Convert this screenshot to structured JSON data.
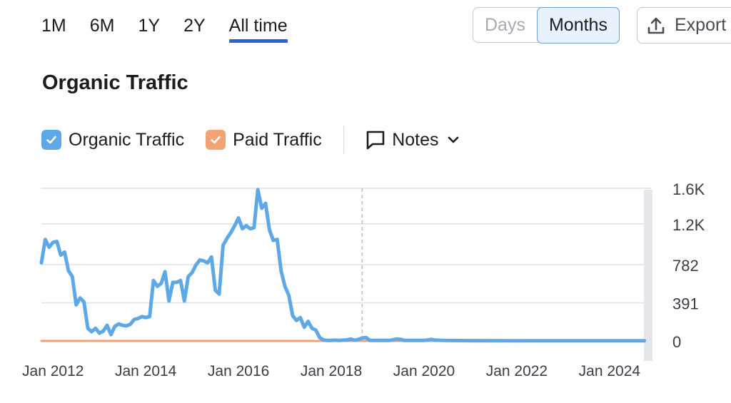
{
  "period_tabs": [
    {
      "label": "1M",
      "active": false
    },
    {
      "label": "6M",
      "active": false
    },
    {
      "label": "1Y",
      "active": false
    },
    {
      "label": "2Y",
      "active": false
    },
    {
      "label": "All time",
      "active": true
    }
  ],
  "granularity": {
    "days_label": "Days",
    "months_label": "Months",
    "selected": "Months"
  },
  "export_label": "Export",
  "icons": {
    "export": "upload-icon",
    "notes": "speech-bubble-icon",
    "dropdown": "chevron-down-icon",
    "check": "checkmark-icon"
  },
  "legend": {
    "organic": {
      "label": "Organic Traffic",
      "checked": true,
      "color": "#5fa8e8"
    },
    "paid": {
      "label": "Paid Traffic",
      "checked": true,
      "color": "#f2a273"
    },
    "notes_label": "Notes"
  },
  "colors": {
    "accent": "#2b64d1",
    "organic": "#5fa8e8",
    "paid": "#f2a273",
    "grid": "#dfe1e6"
  },
  "chart_data": {
    "type": "line",
    "title": "Organic Traffic",
    "x_unit": "month",
    "xlim": [
      "2011-10",
      "2024-11"
    ],
    "ylim": [
      0,
      1564
    ],
    "y_ticks": [
      0,
      391,
      782,
      1200,
      1564
    ],
    "y_tick_labels": [
      "0",
      "391",
      "782",
      "1.2K",
      "1.6K"
    ],
    "x_ticks": [
      "2012-01",
      "2014-01",
      "2016-01",
      "2018-01",
      "2020-01",
      "2022-01",
      "2024-01"
    ],
    "x_tick_labels": [
      "Jan 2012",
      "Jan 2014",
      "Jan 2016",
      "Jan 2018",
      "Jan 2020",
      "Jan 2022",
      "Jan 2024"
    ],
    "annotation_line_x": "2018-09",
    "grid": true,
    "legend_position": "top-left",
    "series": [
      {
        "name": "Organic Traffic",
        "color": "#5fa8e8",
        "points": [
          [
            "2011-10",
            800
          ],
          [
            "2011-11",
            1040
          ],
          [
            "2011-12",
            960
          ],
          [
            "2012-01",
            1010
          ],
          [
            "2012-02",
            1020
          ],
          [
            "2012-03",
            880
          ],
          [
            "2012-04",
            910
          ],
          [
            "2012-05",
            720
          ],
          [
            "2012-06",
            660
          ],
          [
            "2012-07",
            370
          ],
          [
            "2012-08",
            440
          ],
          [
            "2012-09",
            400
          ],
          [
            "2012-10",
            130
          ],
          [
            "2012-11",
            95
          ],
          [
            "2012-12",
            130
          ],
          [
            "2013-01",
            80
          ],
          [
            "2013-02",
            100
          ],
          [
            "2013-03",
            160
          ],
          [
            "2013-04",
            65
          ],
          [
            "2013-05",
            150
          ],
          [
            "2013-06",
            175
          ],
          [
            "2013-07",
            160
          ],
          [
            "2013-08",
            155
          ],
          [
            "2013-09",
            170
          ],
          [
            "2013-10",
            220
          ],
          [
            "2013-11",
            230
          ],
          [
            "2013-12",
            250
          ],
          [
            "2014-01",
            240
          ],
          [
            "2014-02",
            250
          ],
          [
            "2014-03",
            620
          ],
          [
            "2014-04",
            560
          ],
          [
            "2014-05",
            590
          ],
          [
            "2014-06",
            710
          ],
          [
            "2014-07",
            410
          ],
          [
            "2014-08",
            600
          ],
          [
            "2014-09",
            600
          ],
          [
            "2014-10",
            620
          ],
          [
            "2014-11",
            410
          ],
          [
            "2014-12",
            660
          ],
          [
            "2015-01",
            700
          ],
          [
            "2015-02",
            780
          ],
          [
            "2015-03",
            830
          ],
          [
            "2015-04",
            820
          ],
          [
            "2015-05",
            800
          ],
          [
            "2015-06",
            860
          ],
          [
            "2015-07",
            520
          ],
          [
            "2015-08",
            480
          ],
          [
            "2015-09",
            980
          ],
          [
            "2015-10",
            1050
          ],
          [
            "2015-11",
            1110
          ],
          [
            "2015-12",
            1180
          ],
          [
            "2016-01",
            1260
          ],
          [
            "2016-02",
            1150
          ],
          [
            "2016-03",
            1180
          ],
          [
            "2016-04",
            1150
          ],
          [
            "2016-05",
            1160
          ],
          [
            "2016-06",
            1550
          ],
          [
            "2016-07",
            1360
          ],
          [
            "2016-08",
            1410
          ],
          [
            "2016-09",
            1140
          ],
          [
            "2016-10",
            1030
          ],
          [
            "2016-11",
            1040
          ],
          [
            "2016-12",
            720
          ],
          [
            "2017-01",
            560
          ],
          [
            "2017-02",
            470
          ],
          [
            "2017-03",
            260
          ],
          [
            "2017-04",
            210
          ],
          [
            "2017-05",
            240
          ],
          [
            "2017-06",
            140
          ],
          [
            "2017-07",
            200
          ],
          [
            "2017-08",
            130
          ],
          [
            "2017-09",
            110
          ],
          [
            "2017-10",
            35
          ],
          [
            "2017-11",
            10
          ],
          [
            "2017-12",
            5
          ],
          [
            "2018-01",
            5
          ],
          [
            "2018-02",
            8
          ],
          [
            "2018-03",
            5
          ],
          [
            "2018-04",
            8
          ],
          [
            "2018-05",
            10
          ],
          [
            "2018-06",
            20
          ],
          [
            "2018-07",
            8
          ],
          [
            "2018-08",
            15
          ],
          [
            "2018-09",
            30
          ],
          [
            "2018-10",
            35
          ],
          [
            "2018-11",
            5
          ],
          [
            "2019-01",
            5
          ],
          [
            "2019-04",
            5
          ],
          [
            "2019-06",
            20
          ],
          [
            "2019-07",
            15
          ],
          [
            "2019-08",
            5
          ],
          [
            "2020-01",
            5
          ],
          [
            "2020-03",
            15
          ],
          [
            "2020-04",
            8
          ],
          [
            "2020-06",
            5
          ],
          [
            "2021-01",
            3
          ],
          [
            "2022-01",
            2
          ],
          [
            "2023-01",
            2
          ],
          [
            "2024-01",
            2
          ],
          [
            "2024-10",
            2
          ]
        ]
      },
      {
        "name": "Paid Traffic",
        "color": "#f2a273",
        "points": [
          [
            "2011-10",
            0
          ],
          [
            "2024-10",
            0
          ]
        ]
      }
    ]
  }
}
